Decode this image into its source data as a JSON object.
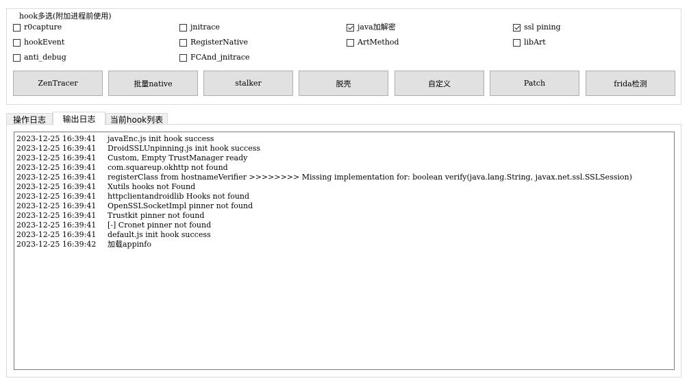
{
  "hook_group": {
    "title": "hook多选(附加进程前使用)",
    "checkboxes": [
      {
        "label": "r0capture",
        "checked": false
      },
      {
        "label": "jnitrace",
        "checked": false
      },
      {
        "label": "java加解密",
        "checked": true
      },
      {
        "label": "ssl pining",
        "checked": true
      },
      {
        "label": "hookEvent",
        "checked": false
      },
      {
        "label": "RegisterNative",
        "checked": false
      },
      {
        "label": "ArtMethod",
        "checked": false
      },
      {
        "label": "libArt",
        "checked": false
      },
      {
        "label": "anti_debug",
        "checked": false
      },
      {
        "label": "FCAnd_jnitrace",
        "checked": false
      }
    ],
    "buttons": [
      "ZenTracer",
      "批量native",
      "stalker",
      "脱壳",
      "自定义",
      "Patch",
      "frida检测"
    ]
  },
  "tabs": [
    {
      "label": "操作日志",
      "active": false
    },
    {
      "label": "输出日志",
      "active": true
    },
    {
      "label": "当前hook列表",
      "active": false
    }
  ],
  "log": [
    {
      "time": "2023-12-25 16:39:41",
      "message": "javaEnc.js init hook success"
    },
    {
      "time": "2023-12-25 16:39:41",
      "message": "DroidSSLUnpinning.js init hook success"
    },
    {
      "time": "2023-12-25 16:39:41",
      "message": "Custom, Empty TrustManager ready"
    },
    {
      "time": "2023-12-25 16:39:41",
      "message": "com.squareup.okhttp not found"
    },
    {
      "time": "2023-12-25 16:39:41",
      "message": "registerClass from hostnameVerifier >>>>>>>> Missing implementation for: boolean verify(java.lang.String, javax.net.ssl.SSLSession)"
    },
    {
      "time": "2023-12-25 16:39:41",
      "message": "Xutils hooks not Found"
    },
    {
      "time": "2023-12-25 16:39:41",
      "message": "httpclientandroidlib Hooks not found"
    },
    {
      "time": "2023-12-25 16:39:41",
      "message": "OpenSSLSocketImpl pinner not found"
    },
    {
      "time": "2023-12-25 16:39:41",
      "message": "Trustkit pinner not found"
    },
    {
      "time": "2023-12-25 16:39:41",
      "message": "[-] Cronet pinner not found"
    },
    {
      "time": "2023-12-25 16:39:41",
      "message": "default.js init hook success"
    },
    {
      "time": "2023-12-25 16:39:42",
      "message": "加载appinfo"
    }
  ]
}
